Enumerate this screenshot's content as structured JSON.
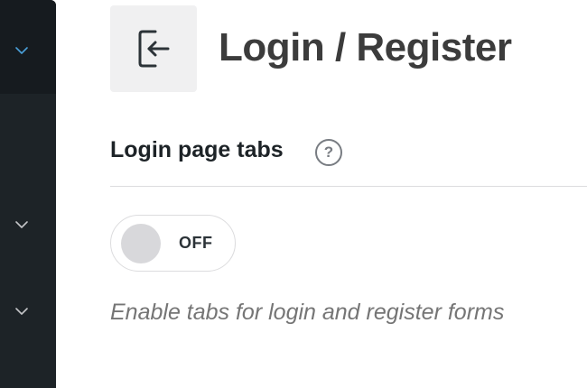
{
  "sidebar": {
    "icons": [
      "chevron-down-icon",
      "chevron-down-icon",
      "chevron-down-icon"
    ],
    "active_chevron_color": "#4a9fd8",
    "chevron_color": "#c3c4c7"
  },
  "header": {
    "icon": "sign-in-icon",
    "title": "Login / Register"
  },
  "section": {
    "title": "Login page tabs",
    "help_icon": "help-icon",
    "help_glyph": "?"
  },
  "toggle": {
    "state": "OFF",
    "enabled": false
  },
  "description": "Enable tabs for login and register forms"
}
